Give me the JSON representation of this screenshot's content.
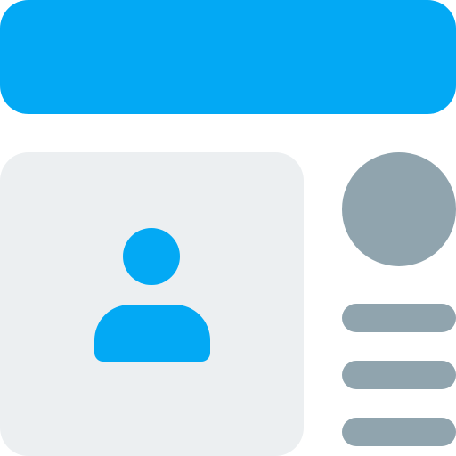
{
  "colors": {
    "header": "#03A9F4",
    "card": "#ECEFF1",
    "user": "#03A9F4",
    "circle": "#90A4AE",
    "lines": "#90A4AE"
  },
  "icons": {
    "user": "user-icon",
    "circle": "circle-avatar",
    "lines": [
      "line-item",
      "line-item",
      "line-item"
    ]
  }
}
